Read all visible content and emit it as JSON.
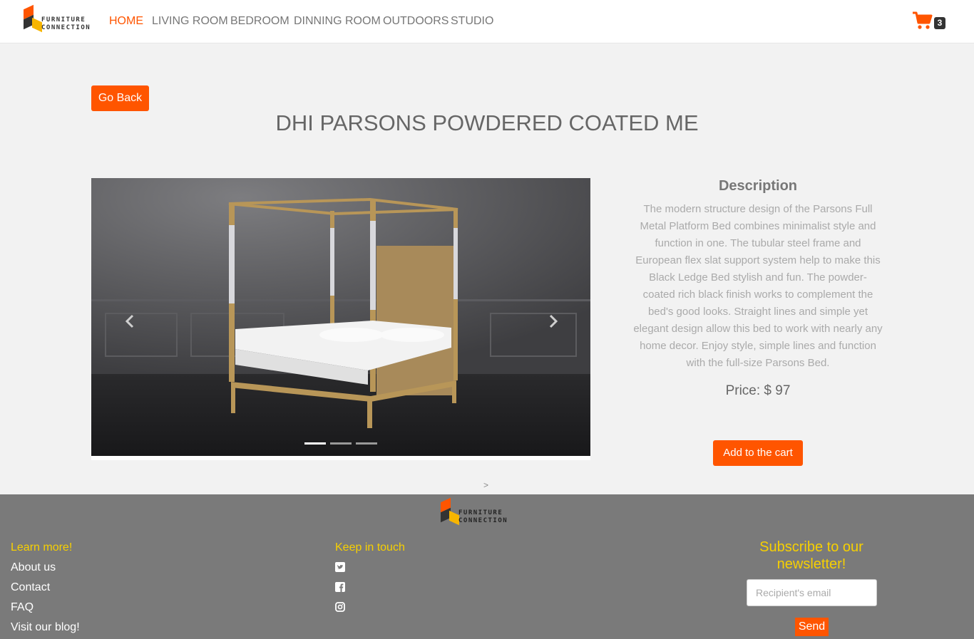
{
  "brand": {
    "line1": "FURNITURE",
    "line2": "CONNECTION"
  },
  "nav": {
    "home": "HOME",
    "living_room": "LIVING ROOM",
    "bedroom": "BEDROOM",
    "dinning_room": "DINNING ROOM",
    "outdoors": "OUTDOORS",
    "studio": "STUDIO"
  },
  "cart": {
    "count": "3",
    "icon": "shopping-cart-icon",
    "color": "#ff5500"
  },
  "product": {
    "go_back_label": "Go Back",
    "title": "DHI PARSONS POWDERED COATED ME",
    "description_heading": "Description",
    "description": "The modern structure design of the Parsons Full Metal Platform Bed combines minimalist style and function in one. The tubular steel frame and European flex slat support system help to make this Black Ledge Bed stylish and fun. The powder-coated rich black finish works to complement the bed's good looks. Straight lines and simple yet elegant design allow this bed to work with nearly any home decor. Enjoy style, simple lines and function with the full-size Parsons Bed.",
    "price": "Price: $ 97",
    "add_to_cart_label": "Add to the cart",
    "carousel_slides": 3,
    "carousel_active": 1,
    "next_link": ">"
  },
  "footer": {
    "learn_more": "Learn more!",
    "links": [
      "About us",
      "Contact",
      "FAQ",
      "Visit our blog!"
    ],
    "keep_in_touch": "Keep in touch",
    "social": [
      "twitter-icon",
      "facebook-icon",
      "instagram-icon"
    ],
    "subscribe_title": "Subscribe to our newsletter!",
    "email_placeholder": "Recipient's email",
    "send_label": "Send"
  },
  "colors": {
    "accent": "#ff5500",
    "footer_bg": "#7a7a7a",
    "footer_heading": "#f7d000"
  }
}
